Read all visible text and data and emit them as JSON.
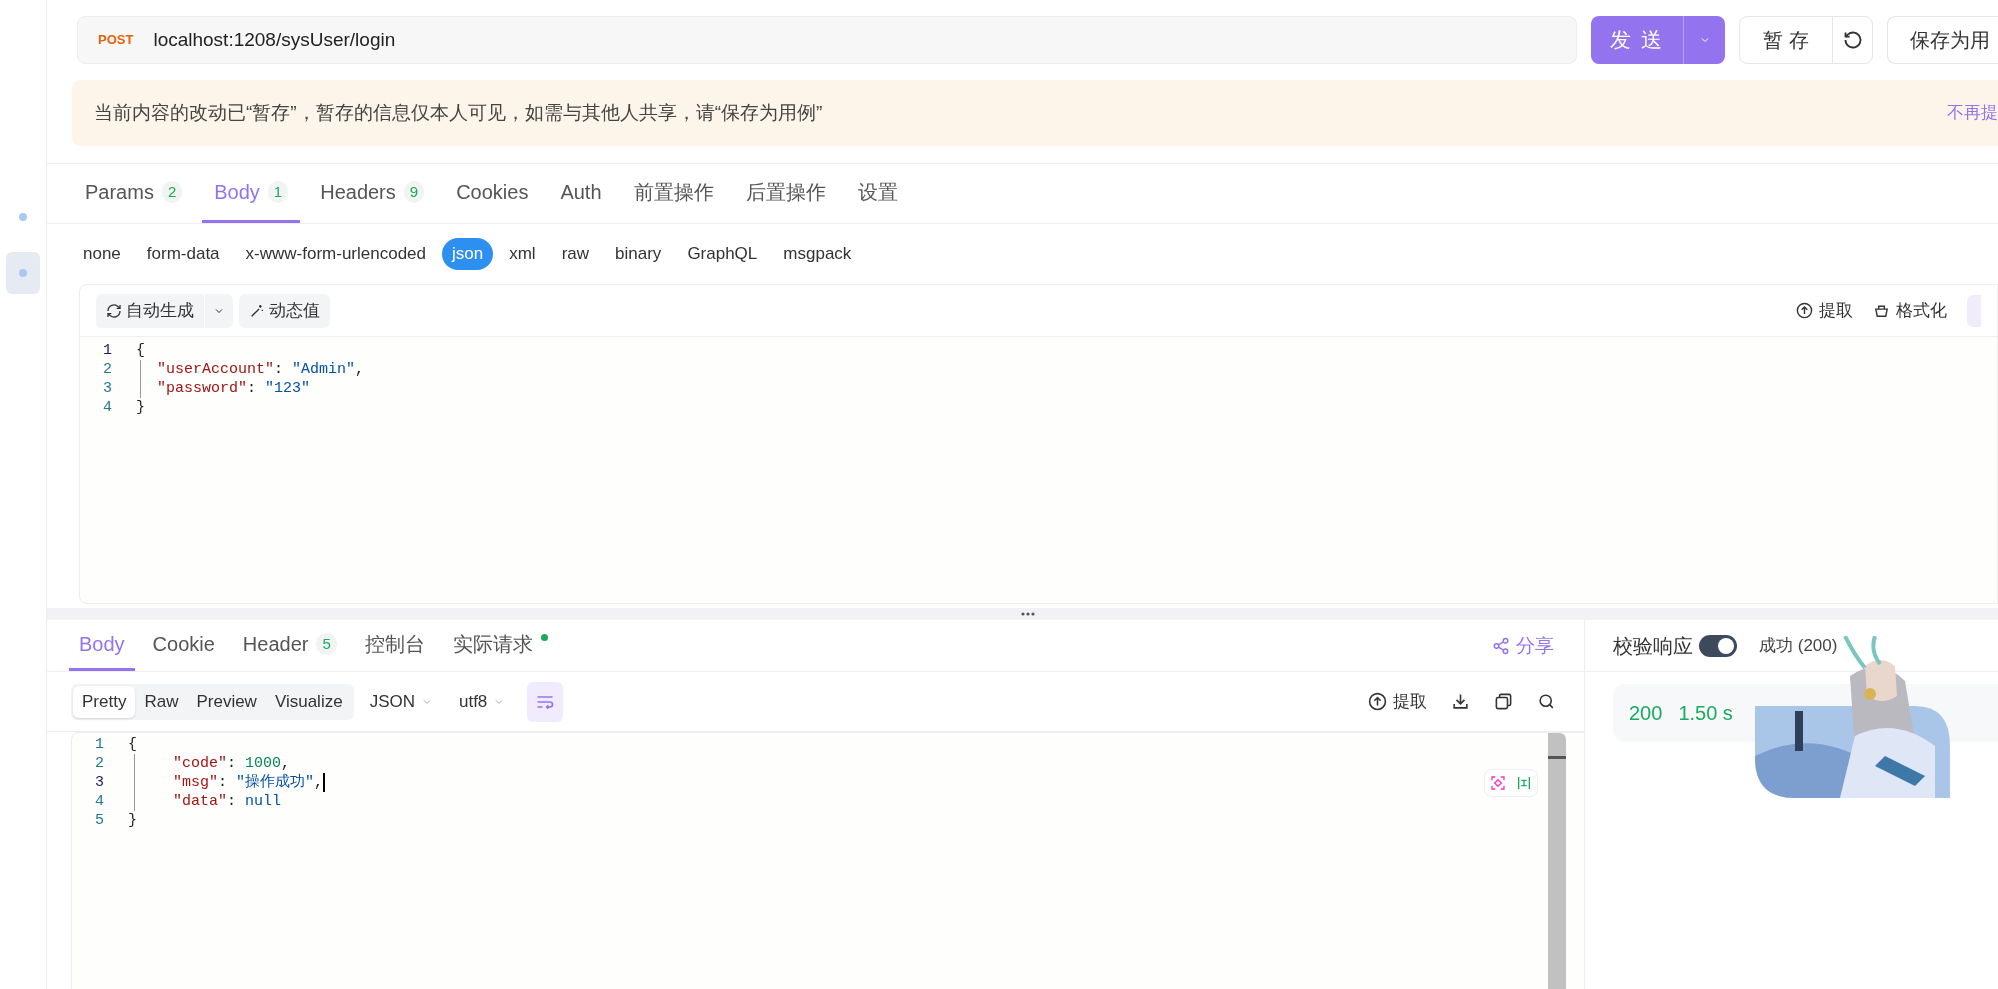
{
  "sidebar": {
    "items": [
      {
        "selected": false
      },
      {
        "selected": true
      }
    ]
  },
  "request": {
    "method": "POST",
    "url": "localhost:1208/sysUser/login"
  },
  "actions": {
    "send": "发 送",
    "save_draft": "暂 存",
    "save_case": "保存为用"
  },
  "notice": {
    "text": "当前内容的改动已“暂存”，暂存的信息仅本人可见，如需与其他人共享，请“保存为用例”",
    "dismiss": "不再提"
  },
  "request_tabs": [
    {
      "label": "Params",
      "count": "2",
      "selected": false
    },
    {
      "label": "Body",
      "count": "1",
      "selected": true
    },
    {
      "label": "Headers",
      "count": "9",
      "selected": false
    },
    {
      "label": "Cookies",
      "selected": false
    },
    {
      "label": "Auth",
      "selected": false
    },
    {
      "label": "前置操作",
      "selected": false
    },
    {
      "label": "后置操作",
      "selected": false
    },
    {
      "label": "设置",
      "selected": false
    }
  ],
  "body_types": [
    {
      "label": "none",
      "selected": false
    },
    {
      "label": "form-data",
      "selected": false
    },
    {
      "label": "x-www-form-urlencoded",
      "selected": false
    },
    {
      "label": "json",
      "selected": true
    },
    {
      "label": "xml",
      "selected": false
    },
    {
      "label": "raw",
      "selected": false
    },
    {
      "label": "binary",
      "selected": false
    },
    {
      "label": "GraphQL",
      "selected": false
    },
    {
      "label": "msgpack",
      "selected": false
    }
  ],
  "body_toolbar": {
    "auto_generate": "自动生成",
    "dynamic_value": "动态值",
    "extract": "提取",
    "format": "格式化"
  },
  "request_body": {
    "lines": [
      {
        "number": "1",
        "active": true,
        "indented": false,
        "tokens": [
          {
            "kind": "punct",
            "text": "{"
          }
        ]
      },
      {
        "number": "2",
        "active": false,
        "indented": true,
        "tokens": [
          {
            "kind": "key",
            "text": "\"userAccount\""
          },
          {
            "kind": "punct",
            "text": ": "
          },
          {
            "kind": "string",
            "text": "\"Admin\""
          },
          {
            "kind": "punct",
            "text": ","
          }
        ]
      },
      {
        "number": "3",
        "active": false,
        "indented": true,
        "tokens": [
          {
            "kind": "key",
            "text": "\"password\""
          },
          {
            "kind": "punct",
            "text": ": "
          },
          {
            "kind": "string",
            "text": "\"123\""
          }
        ]
      },
      {
        "number": "4",
        "active": false,
        "indented": false,
        "tokens": [
          {
            "kind": "punct",
            "text": "}"
          }
        ]
      }
    ]
  },
  "response_tabs": [
    {
      "label": "Body",
      "selected": true,
      "indicator": false
    },
    {
      "label": "Cookie",
      "selected": false,
      "indicator": false
    },
    {
      "label": "Header",
      "count": "5",
      "selected": false,
      "indicator": false
    },
    {
      "label": "控制台",
      "selected": false,
      "indicator": false
    },
    {
      "label": "实际请求",
      "selected": false,
      "indicator": true
    }
  ],
  "share": "分享",
  "response_views": [
    {
      "label": "Pretty",
      "selected": true
    },
    {
      "label": "Raw",
      "selected": false
    },
    {
      "label": "Preview",
      "selected": false
    },
    {
      "label": "Visualize",
      "selected": false
    }
  ],
  "response_format": "JSON",
  "response_encoding": "utf8",
  "response_toolbar": {
    "extract": "提取"
  },
  "response_body": {
    "lines": [
      {
        "number": "1",
        "active": false,
        "indented": false,
        "cursor": false,
        "tokens": [
          {
            "kind": "punct",
            "text": "{"
          }
        ]
      },
      {
        "number": "2",
        "active": false,
        "indented": true,
        "cursor": false,
        "tokens": [
          {
            "kind": "key",
            "text": "\"code\""
          },
          {
            "kind": "punct",
            "text": ": "
          },
          {
            "kind": "number",
            "text": "1000"
          },
          {
            "kind": "punct",
            "text": ","
          }
        ]
      },
      {
        "number": "3",
        "active": true,
        "indented": true,
        "cursor": true,
        "tokens": [
          {
            "kind": "key",
            "text": "\"msg\""
          },
          {
            "kind": "punct",
            "text": ": "
          },
          {
            "kind": "string",
            "text": "\"操作成功\""
          },
          {
            "kind": "punct",
            "text": ","
          }
        ]
      },
      {
        "number": "4",
        "active": false,
        "indented": true,
        "cursor": false,
        "tokens": [
          {
            "kind": "key",
            "text": "\"data\""
          },
          {
            "kind": "punct",
            "text": ": "
          },
          {
            "kind": "null",
            "text": "null"
          }
        ]
      },
      {
        "number": "5",
        "active": false,
        "indented": false,
        "cursor": false,
        "tokens": [
          {
            "kind": "punct",
            "text": "}"
          }
        ]
      }
    ]
  },
  "validation": {
    "label": "校验响应",
    "on": true,
    "result": "成功 (200)"
  },
  "stats": [
    "200",
    "1.50 s"
  ]
}
